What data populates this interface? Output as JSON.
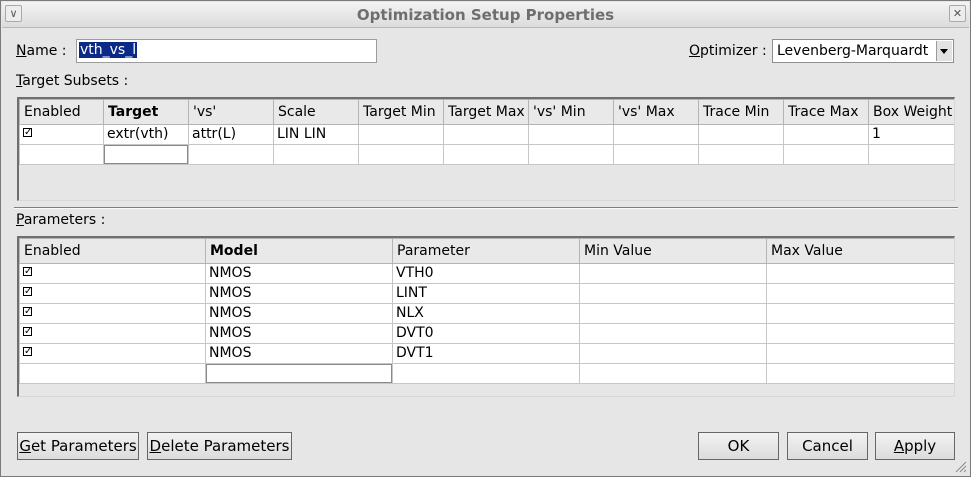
{
  "window": {
    "title": "Optimization Setup Properties"
  },
  "name_field": {
    "label_prefix": "",
    "label_mnemonic": "N",
    "label_rest": "ame :",
    "value": "vth_vs_l"
  },
  "optimizer": {
    "label_mnemonic": "O",
    "label_rest": "ptimizer :",
    "value": "Levenberg-Marquardt"
  },
  "target_subsets": {
    "label_mnemonic": "T",
    "label_rest": "arget Subsets :",
    "columns": [
      "Enabled",
      "Target",
      "'vs'",
      "Scale",
      "Target Min",
      "Target Max",
      "'vs' Min",
      "'vs' Max",
      "Trace Min",
      "Trace Max",
      "Box Weight"
    ],
    "rows": [
      {
        "enabled": true,
        "target": "extr(vth)",
        "vs": "attr(L)",
        "scale": "LIN LIN",
        "target_min": "",
        "target_max": "",
        "vs_min": "",
        "vs_max": "",
        "trace_min": "",
        "trace_max": "",
        "box_weight": "1"
      }
    ]
  },
  "parameters": {
    "label_mnemonic": "P",
    "label_rest": "arameters :",
    "columns": [
      "Enabled",
      "Model",
      "Parameter",
      "Min Value",
      "Max Value"
    ],
    "rows": [
      {
        "enabled": true,
        "model": "NMOS",
        "parameter": "VTH0",
        "min": "",
        "max": ""
      },
      {
        "enabled": true,
        "model": "NMOS",
        "parameter": "LINT",
        "min": "",
        "max": ""
      },
      {
        "enabled": true,
        "model": "NMOS",
        "parameter": "NLX",
        "min": "",
        "max": ""
      },
      {
        "enabled": true,
        "model": "NMOS",
        "parameter": "DVT0",
        "min": "",
        "max": ""
      },
      {
        "enabled": true,
        "model": "NMOS",
        "parameter": "DVT1",
        "min": "",
        "max": ""
      }
    ]
  },
  "buttons": {
    "get_parameters": {
      "mnemonic": "G",
      "rest": "et Parameters"
    },
    "delete_parameters": {
      "mnemonic": "D",
      "rest": "elete Parameters"
    },
    "ok": "OK",
    "cancel": "Cancel",
    "apply": {
      "mnemonic": "A",
      "rest": "pply"
    }
  },
  "icons": {
    "titlebar_left": "chevron-down-icon",
    "titlebar_right": "close-icon",
    "check": "checkmark-icon",
    "resize": "resize-grip-icon"
  }
}
